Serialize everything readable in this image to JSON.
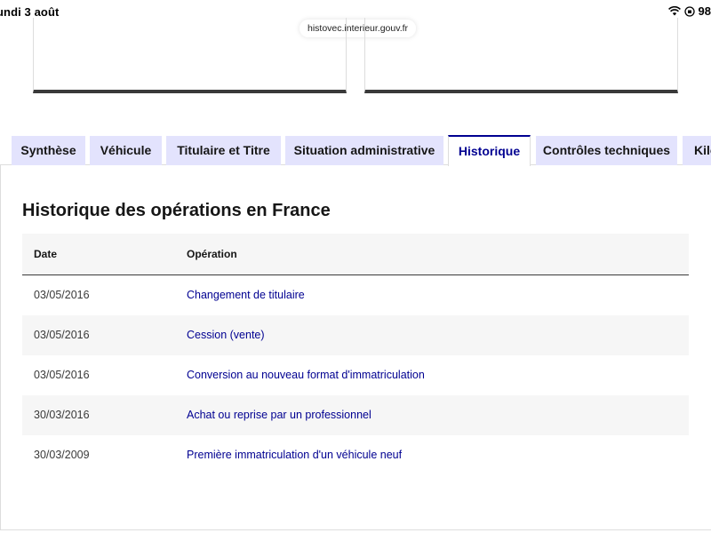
{
  "status_bar": {
    "date": "undi 3 août",
    "battery": "98"
  },
  "browser": {
    "url": "histovec.interieur.gouv.fr"
  },
  "tabs": [
    {
      "label": "Synthèse",
      "active": false
    },
    {
      "label": "Véhicule",
      "active": false
    },
    {
      "label": "Titulaire et Titre",
      "active": false
    },
    {
      "label": "Situation administrative",
      "active": false
    },
    {
      "label": "Historique",
      "active": true
    },
    {
      "label": "Contrôles techniques",
      "active": false
    },
    {
      "label": "Kilo",
      "active": false
    }
  ],
  "history": {
    "title": "Historique des opérations en France",
    "columns": {
      "date": "Date",
      "operation": "Opération"
    },
    "rows": [
      {
        "date": "03/05/2016",
        "operation": "Changement de titulaire"
      },
      {
        "date": "03/05/2016",
        "operation": "Cession (vente)"
      },
      {
        "date": "03/05/2016",
        "operation": "Conversion au nouveau format d'immatriculation"
      },
      {
        "date": "30/03/2016",
        "operation": "Achat ou reprise par un professionnel"
      },
      {
        "date": "30/03/2009",
        "operation": "Première immatriculation d'un véhicule neuf"
      }
    ]
  },
  "colors": {
    "accent_blue": "#000091",
    "tab_background": "#e3e3fd",
    "row_alt_background": "#f6f6f6",
    "border_dark": "#3a3a3a"
  }
}
